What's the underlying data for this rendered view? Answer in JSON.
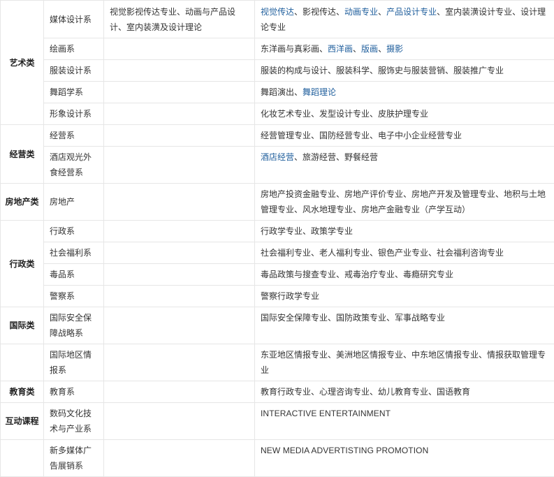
{
  "categories": {
    "arts": "艺术类",
    "business": "经营类",
    "realestate": "房地产类",
    "admin": "行政类",
    "intl": "国际类",
    "edu": "教育类",
    "interactive": "互动课程"
  },
  "rows": [
    {
      "dept": "媒体设计系",
      "mid": "视觉影视传达专业、动画与产品设计、室内装潢及设计理论",
      "majors_pre": "",
      "majors_hl1": "视觉传达",
      "majors_t1": "、影视传达、",
      "majors_hl2": "动画专业",
      "majors_t2": "、",
      "majors_hl3": "产品设计专业",
      "majors_t3": "、室内装潢设计专业、设计理论专业"
    },
    {
      "dept": "绘画系",
      "majors_t0": "东洋画与真彩画、",
      "majors_hl1": "西洋画",
      "majors_s1": "、",
      "majors_hl2": "版画",
      "majors_s2": "、",
      "majors_hl3": "摄影"
    },
    {
      "dept": "服装设计系",
      "majors": "服装的构成与设计、服装科学、服饰史与服装营销、服装推广专业"
    },
    {
      "dept": "舞蹈学系",
      "majors_t0": "舞蹈演出、",
      "majors_hl1": "舞蹈理论"
    },
    {
      "dept": "形象设计系",
      "majors": "化妆艺术专业、发型设计专业、皮肤护理专业"
    },
    {
      "dept": "经营系",
      "majors": "经营管理专业、国防经营专业、电子中小企业经营专业"
    },
    {
      "dept": "酒店观光外食经营系",
      "majors_hl1": "酒店经营",
      "majors_t1": "、旅游经营、野餐经营"
    },
    {
      "dept": "房地产",
      "majors": "房地产投资金融专业、房地产评价专业、房地产开发及管理专业、地积与土地管理专业、风水地理专业、房地产金融专业（产学互动）"
    },
    {
      "dept": "行政系",
      "majors": "行政学专业、政策学专业"
    },
    {
      "dept": "社会福利系",
      "majors": "社会福利专业、老人福利专业、银色产业专业、社会福利咨询专业"
    },
    {
      "dept": "毒品系",
      "majors": "毒品政策与搜查专业、戒毒治疗专业、毒瘾研究专业"
    },
    {
      "dept": "警察系",
      "majors": "警察行政学专业"
    },
    {
      "dept": "国际安全保障战略系",
      "majors": "国际安全保障专业、国防政策专业、军事战略专业"
    },
    {
      "dept": "国际地区情报系",
      "majors": "东亚地区情报专业、美洲地区情报专业、中东地区情报专业、情报获取管理专业"
    },
    {
      "dept": "教育系",
      "majors": "教育行政专业、心理咨询专业、幼儿教育专业、国语教育"
    },
    {
      "dept": "数码文化技术与产业系",
      "majors": "INTERACTIVE ENTERTAINMENT"
    },
    {
      "dept": "新多媒体广告展销系",
      "majors": "NEW MEDIA ADVERTISTING PROMOTION"
    }
  ],
  "colors": {
    "link": "#1f5e9c",
    "border": "#e6e6e6",
    "text": "#333333"
  }
}
